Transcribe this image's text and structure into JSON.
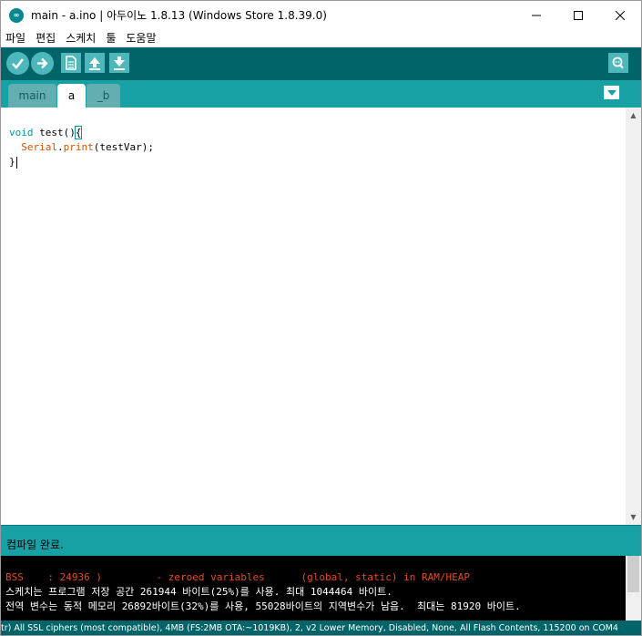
{
  "window": {
    "title": "main - a.ino | 아두이노 1.8.13 (Windows Store 1.8.39.0)",
    "controls": {
      "minimize": "—",
      "maximize": "☐",
      "close": "✕"
    }
  },
  "menu": [
    "파일",
    "편집",
    "스케치",
    "툴",
    "도움말"
  ],
  "toolbar": {
    "verify_icon": "check-icon",
    "upload_icon": "arrow-right-icon",
    "new_icon": "new-file-icon",
    "open_icon": "arrow-up-icon",
    "save_icon": "arrow-down-icon",
    "monitor_icon": "serial-monitor-icon"
  },
  "tabs": [
    {
      "label": "main",
      "active": false
    },
    {
      "label": "a",
      "active": true
    },
    {
      "label": "_b",
      "active": false
    }
  ],
  "editor": {
    "line1_kw": "void",
    "line1_rest": " test()",
    "line1_brace": "{",
    "line2_indent": "  ",
    "line2_obj": "Serial",
    "line2_dot": ".",
    "line2_fn": "print",
    "line2_rest": "(testVar);",
    "line3": "}"
  },
  "status": {
    "message": "컴파일 완료."
  },
  "console": {
    "lines": [
      {
        "text": "BSS    : 24936 )         - zeroed variables      (global, static) in RAM/HEAP",
        "kind": "error"
      },
      {
        "text": "스케치는 프로그램 저장 공간 261944 바이트(25%)를 사용. 최대 1044464 바이트.",
        "kind": "output"
      },
      {
        "text": "전역 변수는 동적 메모리 26892바이트(32%)를 사용, 55028바이트의 지역변수가 남음.  최대는 81920 바이트.",
        "kind": "output"
      }
    ]
  },
  "board_info": "tr)  All SSL ciphers (most compatible), 4MB (FS:2MB OTA:~1019KB), 2, v2 Lower Memory, Disabled, None, All Flash Contents, 115200 on COM4",
  "colors": {
    "toolbar": "#006468",
    "tabrow": "#17a1a5",
    "button": "#4db7bb",
    "keyword": "#00979c",
    "function": "#d35400",
    "console_error": "#e34c22"
  }
}
